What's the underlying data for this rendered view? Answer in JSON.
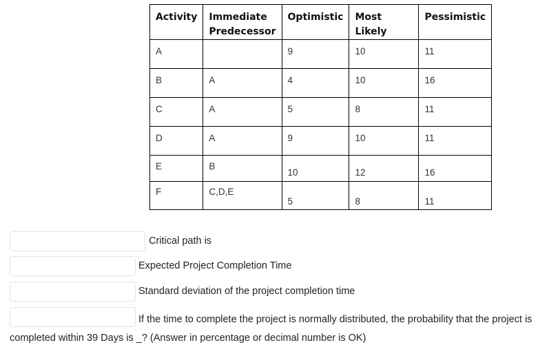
{
  "table": {
    "headers": [
      "Activity",
      "Immediate Predecessor",
      "Optimistic",
      "Most Likely",
      "Pessimistic"
    ],
    "rows": [
      {
        "activity": "A",
        "predecessor": "",
        "optimistic": "9",
        "most_likely": "10",
        "pessimistic": "11"
      },
      {
        "activity": "B",
        "predecessor": "A",
        "optimistic": "4",
        "most_likely": "10",
        "pessimistic": "16"
      },
      {
        "activity": "C",
        "predecessor": "A",
        "optimistic": "5",
        "most_likely": "8",
        "pessimistic": "11"
      },
      {
        "activity": "D",
        "predecessor": "A",
        "optimistic": "9",
        "most_likely": "10",
        "pessimistic": "11"
      },
      {
        "activity": "E",
        "predecessor": "B",
        "optimistic": "10",
        "most_likely": "12",
        "pessimistic": "16"
      },
      {
        "activity": "F",
        "predecessor": "C,D,E",
        "optimistic": "5",
        "most_likely": "8",
        "pessimistic": "11"
      }
    ]
  },
  "questions": [
    {
      "label": "Critical path is",
      "value": ""
    },
    {
      "label": "Expected Project Completion Time",
      "value": ""
    },
    {
      "label": "Standard deviation of the project completion time",
      "value": ""
    },
    {
      "label": "If the time to complete the project is normally distributed, the probability that the project is completed within 39 Days is _? (Answer in percentage or decimal number is OK)",
      "value": ""
    }
  ]
}
